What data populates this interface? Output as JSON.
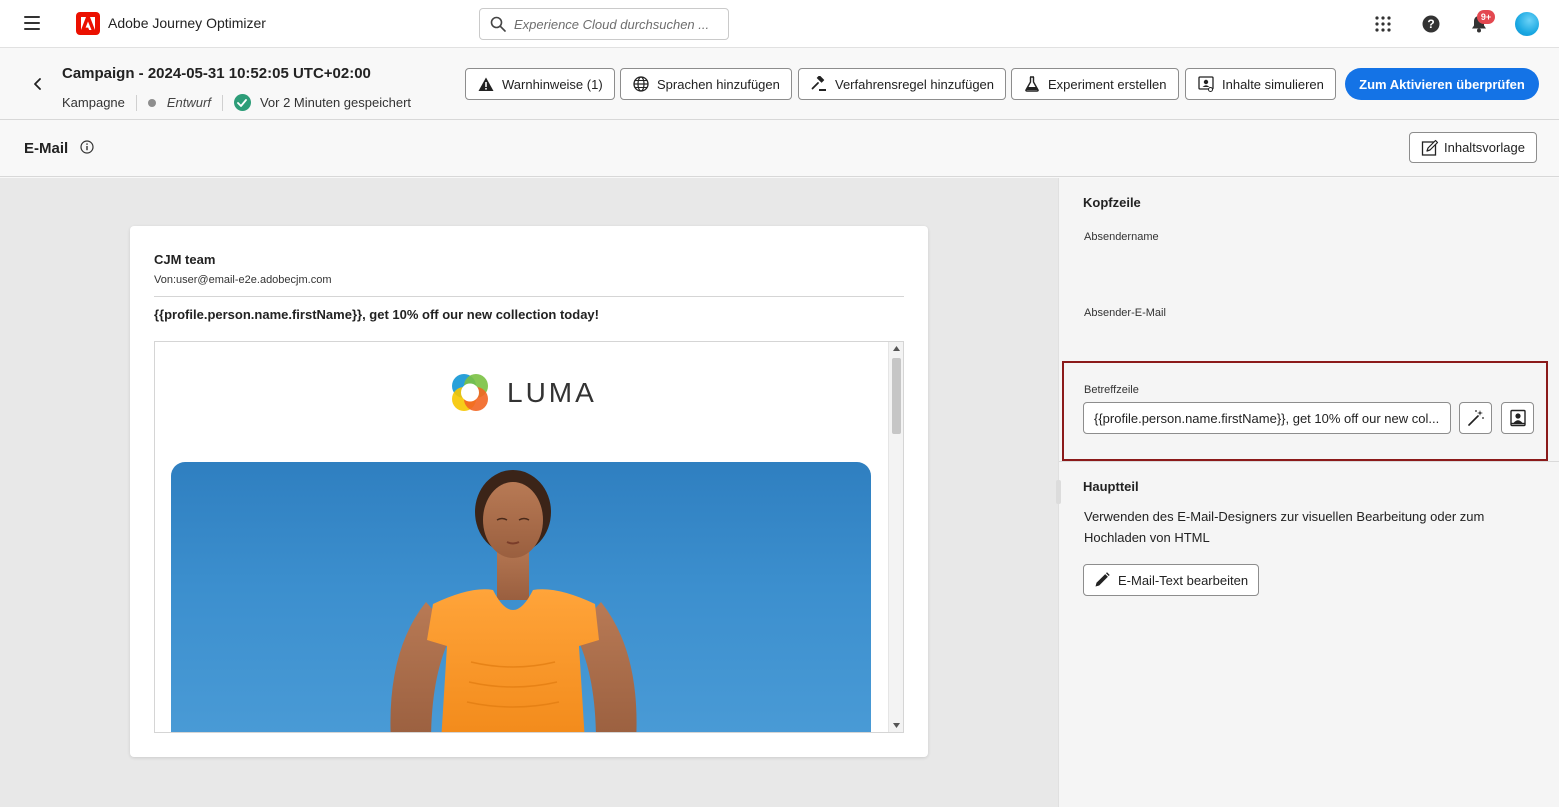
{
  "app": {
    "title": "Adobe Journey Optimizer",
    "search_placeholder": "Experience Cloud durchsuchen ...",
    "notification_count": "9+"
  },
  "campaign": {
    "title": "Campaign - 2024-05-31 10:52:05 UTC+02:00",
    "type": "Kampagne",
    "status": "Entwurf",
    "saved": "Vor 2 Minuten gespeichert",
    "actions": {
      "warnings": "Warnhinweise (1)",
      "languages": "Sprachen hinzufügen",
      "policy": "Verfahrensregel hinzufügen",
      "experiment": "Experiment erstellen",
      "simulate": "Inhalte simulieren",
      "activate": "Zum Aktivieren überprüfen"
    }
  },
  "email": {
    "title": "E-Mail",
    "template_button": "Inhaltsvorlage",
    "preview": {
      "sender_name": "CJM team",
      "from": "Von:user@email-e2e.adobecjm.com",
      "subject": "{{profile.person.name.firstName}}, get 10% off our new collection today!",
      "brand": "LUMA"
    }
  },
  "panel": {
    "header_section": "Kopfzeile",
    "sender_name_label": "Absendername",
    "sender_email_label": "Absender-E-Mail",
    "subject_label": "Betreffzeile",
    "subject_value": "{{profile.person.name.firstName}}, get 10% off our new col...",
    "body_section": "Hauptteil",
    "body_description": "Verwenden des E-Mail-Designers zur visuellen Bearbeitung oder zum Hochladen von HTML",
    "edit_button": "E-Mail-Text bearbeiten"
  },
  "colors": {
    "accent": "#1473e6",
    "brand_red": "#eb1000",
    "highlight_border": "#8b1a1a",
    "saved_green": "#2d9d78"
  }
}
